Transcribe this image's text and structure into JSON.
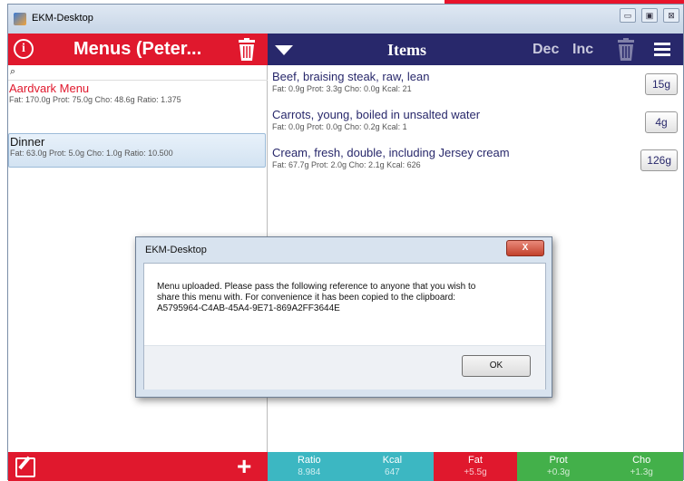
{
  "window": {
    "title": "EKM-Desktop",
    "minimize_icon": "minimize-icon",
    "restore_icon": "restore-icon",
    "close_icon": "close-icon"
  },
  "left": {
    "title": "Menus (Peter...",
    "search_icon": "search-icon",
    "menus": [
      {
        "name": "Aardvark Menu",
        "detail": "Fat: 170.0g Prot: 75.0g Cho: 48.6g Ratio: 1.375"
      },
      {
        "name": "Dinner",
        "detail": "Fat: 63.0g Prot: 5.0g Cho: 1.0g Ratio: 10.500"
      }
    ]
  },
  "right": {
    "title": "Items",
    "dec_label": "Dec",
    "inc_label": "Inc",
    "items": [
      {
        "name": "Beef, braising steak, raw, lean",
        "detail": "Fat: 0.9g Prot: 3.3g Cho: 0.0g Kcal: 21",
        "qty": "15g"
      },
      {
        "name": "Carrots, young, boiled in unsalted water",
        "detail": "Fat: 0.0g Prot: 0.0g Cho: 0.2g Kcal: 1",
        "qty": "4g"
      },
      {
        "name": "Cream, fresh, double, including Jersey cream",
        "detail": "Fat: 67.7g Prot: 2.0g Cho: 2.1g Kcal: 626",
        "qty": "126g"
      }
    ]
  },
  "stats": [
    {
      "label": "Ratio",
      "value": "8.984",
      "color": "#3cb7c2"
    },
    {
      "label": "Kcal",
      "value": "647",
      "color": "#3cb7c2"
    },
    {
      "label": "Fat",
      "value": "+5.5g",
      "color": "#e0182d"
    },
    {
      "label": "Prot",
      "value": "+0.3g",
      "color": "#43b04a"
    },
    {
      "label": "Cho",
      "value": "+1.3g",
      "color": "#43b04a"
    }
  ],
  "dialog": {
    "title": "EKM-Desktop",
    "close_label": "X",
    "message_line1": "Menu uploaded. Please pass the following reference to anyone that you wish to",
    "message_line2": "share this menu with. For convenience it has been copied to the clipboard:",
    "message_line3": "A5795964-C4AB-45A4-9E71-869A2FF3644E",
    "ok_label": "OK"
  },
  "colors": {
    "menu_red": "#e0182d",
    "items_navy": "#28286b"
  }
}
